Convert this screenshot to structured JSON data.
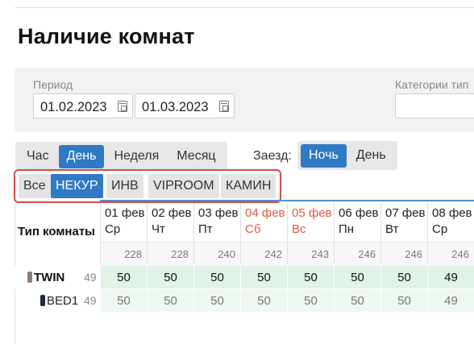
{
  "page": {
    "title": "Наличие комнат"
  },
  "filters": {
    "period_label": "Период",
    "date_from": "01.02.2023",
    "date_to": "01.03.2023",
    "categories_label": "Категории тип"
  },
  "granularity": {
    "options": [
      "Час",
      "День",
      "Неделя",
      "Месяц"
    ],
    "selected": "День"
  },
  "checkin": {
    "label": "Заезд:",
    "options": [
      "Ночь",
      "День"
    ],
    "selected": "Ночь"
  },
  "category_tabs": {
    "options": [
      "Все",
      "НЕКУР",
      "ИНВ",
      "VIPROOM",
      "КАМИН"
    ],
    "selected": "НЕКУР"
  },
  "table": {
    "room_type_header": "Тип комнаты",
    "columns": [
      {
        "date": "01 фев",
        "weekday": "Ср",
        "total": "228",
        "weekend": false
      },
      {
        "date": "02 фев",
        "weekday": "Чт",
        "total": "228",
        "weekend": false
      },
      {
        "date": "03 фев",
        "weekday": "Пт",
        "total": "240",
        "weekend": false
      },
      {
        "date": "04 фев",
        "weekday": "Сб",
        "total": "242",
        "weekend": true
      },
      {
        "date": "05 фев",
        "weekday": "Вс",
        "total": "243",
        "weekend": true
      },
      {
        "date": "06 фев",
        "weekday": "Пн",
        "total": "246",
        "weekend": false
      },
      {
        "date": "07 фев",
        "weekday": "Вт",
        "total": "246",
        "weekend": false
      },
      {
        "date": "08 фев",
        "weekday": "Ср",
        "total": "246",
        "weekend": false
      }
    ],
    "rows": [
      {
        "name": "TWIN",
        "count": "49",
        "values": [
          "50",
          "50",
          "50",
          "50",
          "50",
          "50",
          "50",
          "49"
        ]
      },
      {
        "name": "BED1",
        "count": "49",
        "values": [
          "50",
          "50",
          "50",
          "50",
          "50",
          "50",
          "50",
          "49"
        ]
      }
    ]
  },
  "colors": {
    "accent": "#2f7ac5",
    "weekend": "#e05a45",
    "highlight": "#d94a4a",
    "available_bg": "#dff3e6"
  }
}
